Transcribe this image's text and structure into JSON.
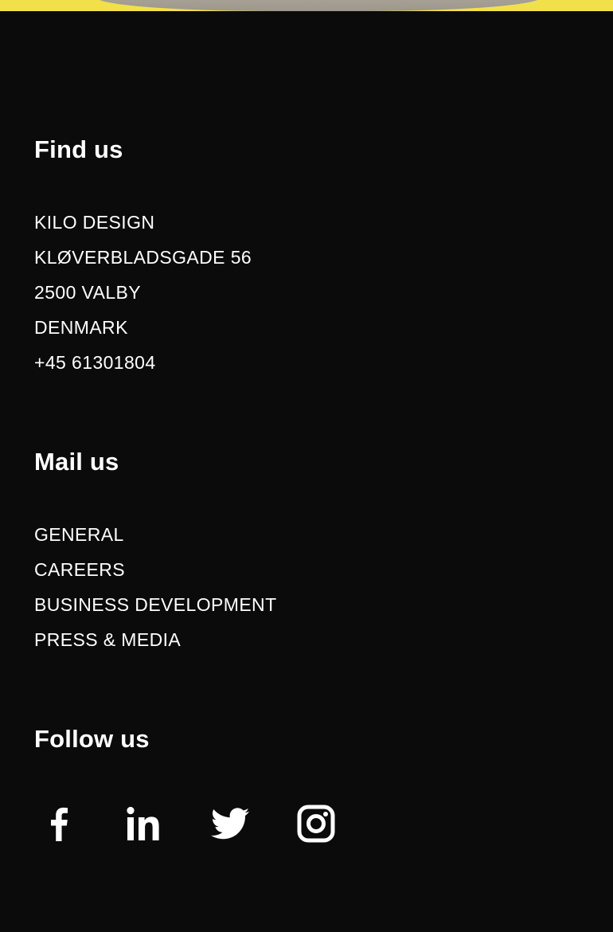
{
  "find_us": {
    "heading": "Find us",
    "lines": [
      "KILO DESIGN",
      "KLØVERBLADSGADE 56",
      "2500 VALBY",
      "DENMARK",
      "+45 61301804"
    ]
  },
  "mail_us": {
    "heading": "Mail us",
    "links": [
      "GENERAL",
      "CAREERS",
      "BUSINESS DEVELOPMENT",
      "PRESS & MEDIA"
    ]
  },
  "follow_us": {
    "heading": "Follow us",
    "icons": [
      "facebook-icon",
      "linkedin-icon",
      "twitter-icon",
      "instagram-icon"
    ]
  },
  "colors": {
    "background": "#0b0b0b",
    "text": "#ffffff",
    "accent": "#f2e04a"
  }
}
